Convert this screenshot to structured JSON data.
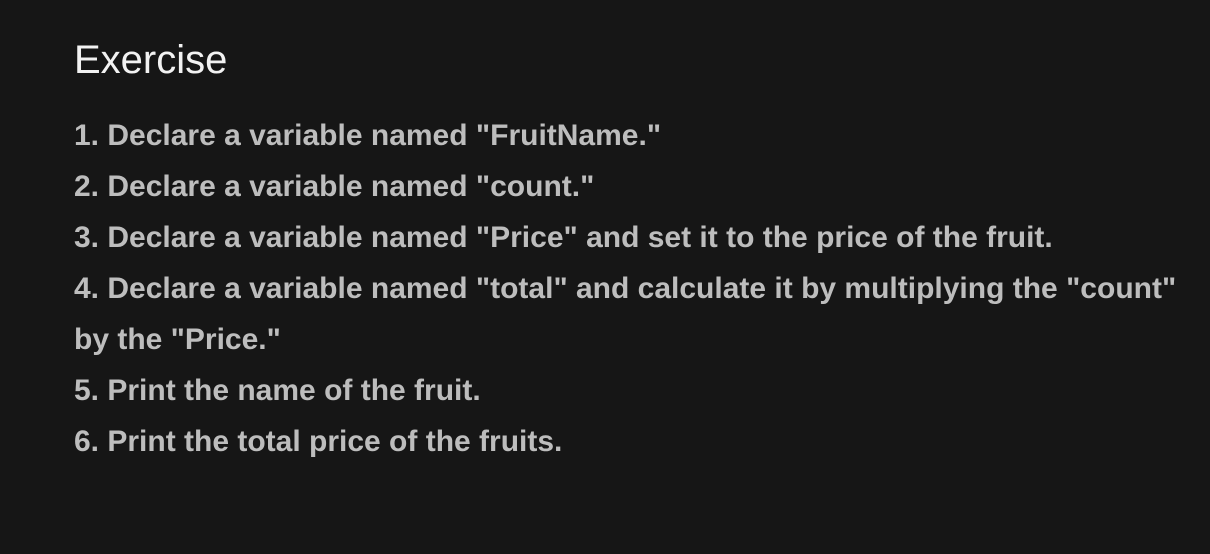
{
  "slide": {
    "title": "Exercise",
    "steps": [
      "1. Declare a variable named \"FruitName.\"",
      "2. Declare a variable named \"count.\"",
      "3. Declare a variable named \"Price\" and set it to the price of the fruit.",
      "4. Declare a variable named \"total\" and calculate it by multiplying the \"count\" by the \"Price.\"",
      "5. Print the name of the fruit.",
      "6. Print the total price of the fruits."
    ]
  },
  "colors": {
    "background": "#161616",
    "title": "#f2f2f2",
    "body_text": "#bdbdbd"
  }
}
